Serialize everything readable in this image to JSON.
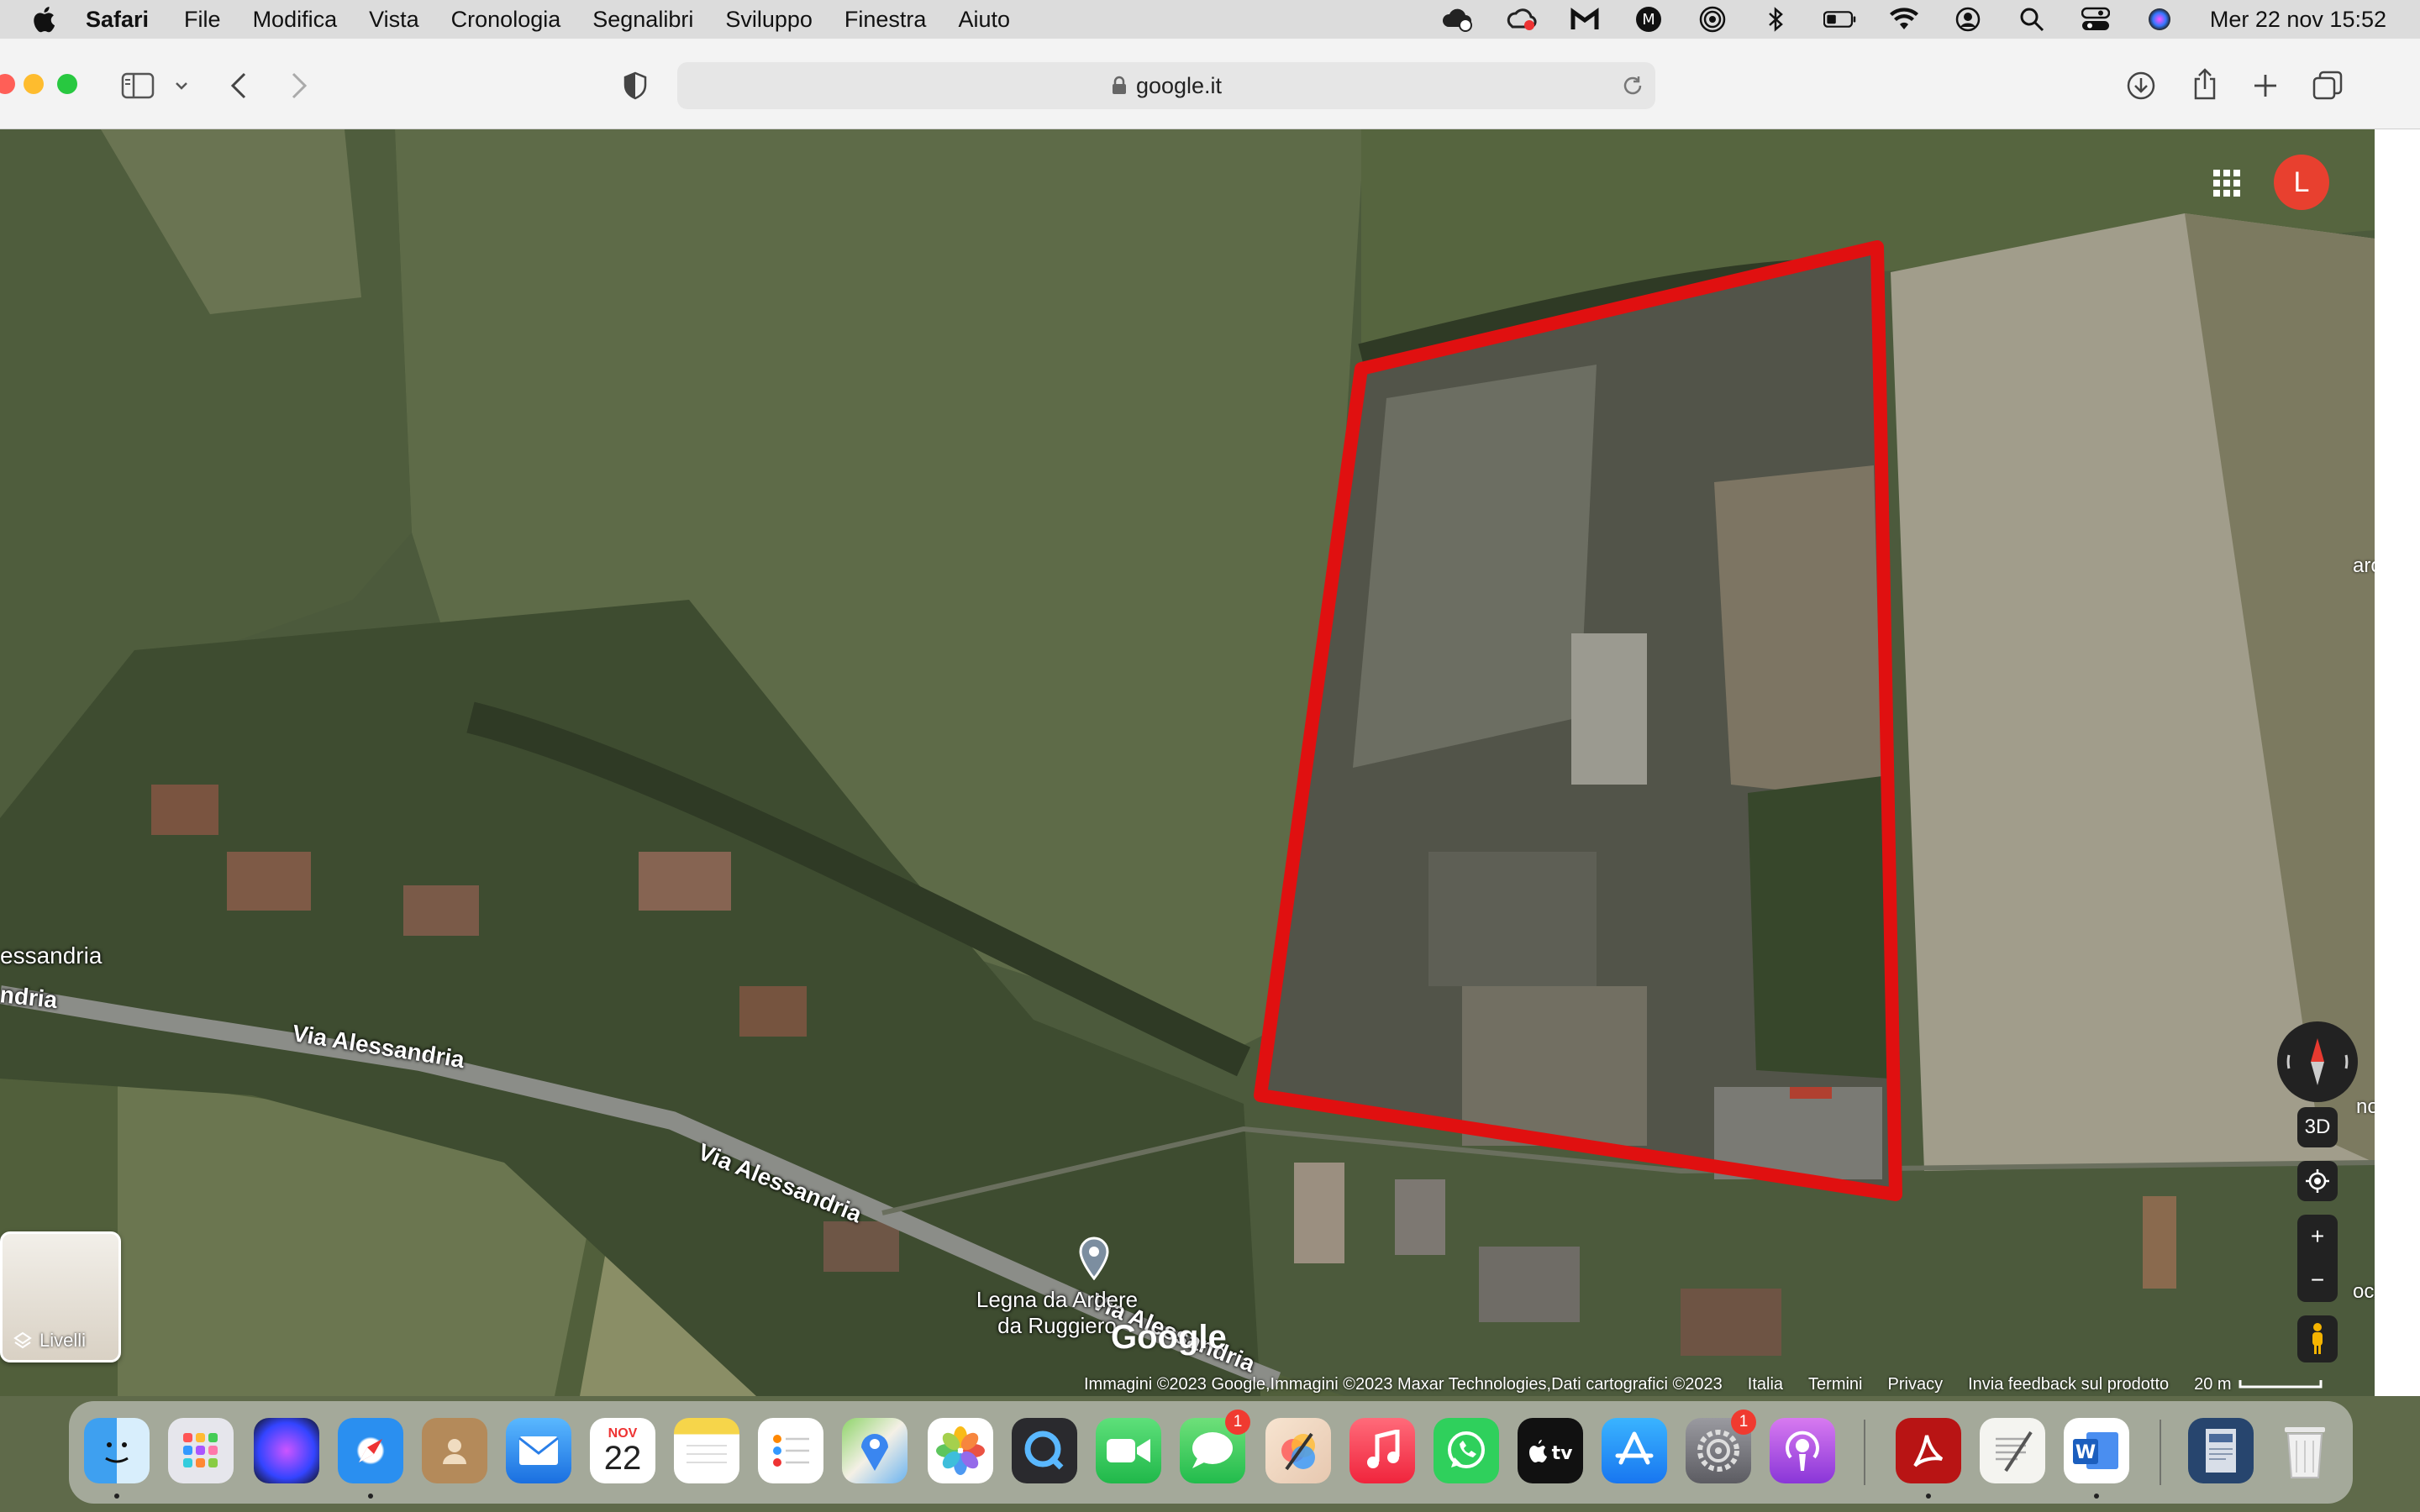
{
  "menubar": {
    "app_name": "Safari",
    "items": [
      "File",
      "Modifica",
      "Vista",
      "Cronologia",
      "Segnalibri",
      "Sviluppo",
      "Finestra",
      "Aiuto"
    ],
    "clock": "Mer 22 nov  15:52"
  },
  "browser": {
    "url": "google.it"
  },
  "map": {
    "road_labels": {
      "a": "Via Alessandria",
      "b": "Via Alessandria",
      "c": "Via Alessandria",
      "d": "essandria",
      "e": "ndria"
    },
    "poi_label_line1": "Legna da Ardere",
    "poi_label_line2": "da Ruggiero",
    "google_logo": "Google",
    "attribution": "Immagini ©2023 Google,Immagini ©2023 Maxar Technologies,Dati cartografici ©2023",
    "links": [
      "Italia",
      "Termini",
      "Privacy",
      "Invia feedback sul prodotto"
    ],
    "scale": "20 m",
    "layers_label": "Livelli",
    "btn_3d": "3D",
    "zoom_in": "+",
    "zoom_out": "−",
    "avatar_letter": "L",
    "edge_labels": [
      "aro",
      "no",
      "ocx"
    ],
    "highlight_color": "#e01010"
  },
  "dock": {
    "calendar_month": "NOV",
    "calendar_day": "22",
    "messages_badge": "1",
    "settings_badge": "1"
  }
}
